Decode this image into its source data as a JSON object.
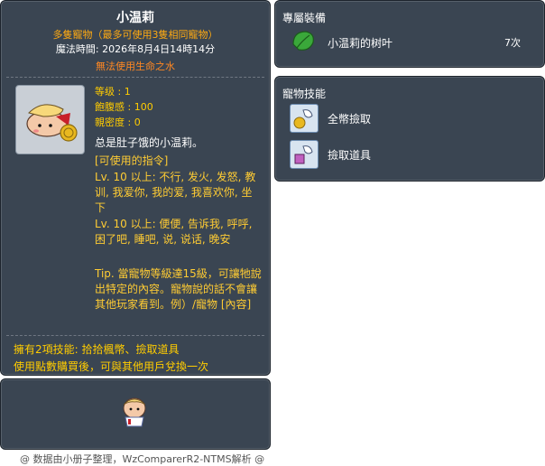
{
  "item_code": "05002300",
  "left": {
    "name": "小温莉",
    "subtitle": "多隻寵物（最多可使用3隻相同寵物）",
    "magic_time": "魔法時間: 2026年8月4日14時14分",
    "warning": "無法使用生命之水",
    "stats": {
      "level": "等级 : 1",
      "fullness": "飽腹感 : 100",
      "intimacy": "親密度 : 0"
    },
    "description": "总是肚子饿的小温莉。",
    "commands_header": "[可使用的指令]",
    "command1": "Lv. 10 以上: 不行, 发火, 发怒, 教训, 我爱你, 我的爱, 我喜欢你, 坐下",
    "command2": "Lv. 10 以上: 便便, 告诉我, 呼呼, 困了吧, 睡吧, 说, 说话, 晚安",
    "tip": "Tip. 當寵物等級達15級，可讓牠說出特定的內容。寵物說的話不會讓其他玩家看到。例）/寵物 [內容]",
    "skills_line": "擁有2項技能: 拾拾楓幣、撿取道具",
    "trade_line": "使用點數購買後，可與其他用戶兌換一次"
  },
  "credit": "@ 数据由小册子整理，WzComparerR2-NTMS解析 @",
  "equip": {
    "title": "專屬裝備",
    "items": [
      {
        "label": "小温莉的树叶",
        "count": "7次",
        "icon": "green-leaf-icon"
      }
    ]
  },
  "skills": {
    "title": "寵物技能",
    "items": [
      {
        "label": "全幣撿取",
        "icon": "meso-pickup-icon"
      },
      {
        "label": "撿取道具",
        "icon": "item-pickup-icon"
      }
    ]
  }
}
